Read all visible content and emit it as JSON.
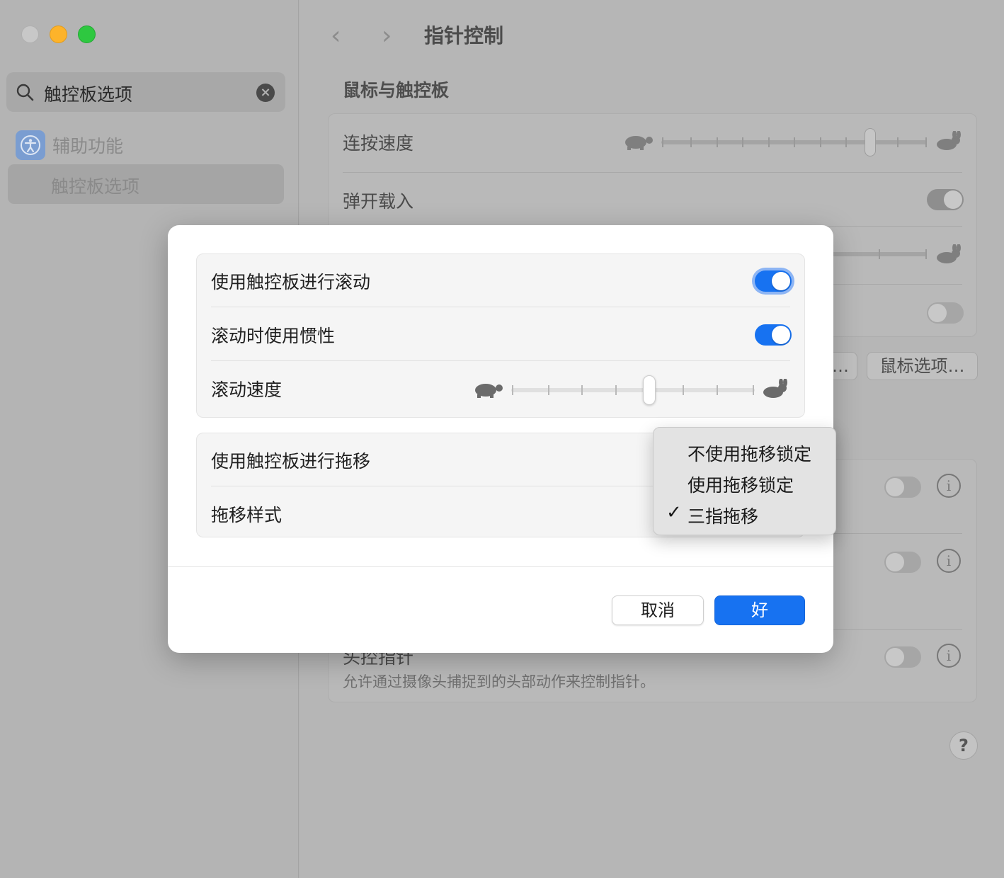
{
  "window": {
    "sidebar": {
      "search_value": "触控板选项",
      "group_label": "辅助功能",
      "selected_item": "触控板选项"
    },
    "header": {
      "back": "‹",
      "forward": "›",
      "title": "指针控制"
    },
    "mouse_trackpad": {
      "section_title": "鼠标与触控板",
      "double_click_speed_label": "连按速度",
      "spring_loading_label": "弹开载入",
      "mouse_options_button": "鼠标选项…",
      "partial_button": "…"
    },
    "head_pointer": {
      "title": "头控指针",
      "description": "允许通过摄像头捕捉到的头部动作来控制指针。"
    },
    "help_label": "?"
  },
  "dialog": {
    "scrolling": {
      "use_trackpad_scroll_label": "使用触控板进行滚动",
      "use_trackpad_scroll_on": true,
      "inertia_label": "滚动时使用惯性",
      "inertia_on": true,
      "scroll_speed_label": "滚动速度"
    },
    "dragging": {
      "use_trackpad_drag_label": "使用触控板进行拖移",
      "drag_style_label": "拖移样式"
    },
    "drag_style_menu": {
      "options": [
        "不使用拖移锁定",
        "使用拖移锁定",
        "三指拖移"
      ],
      "selected": "三指拖移",
      "checkmark": "✓"
    },
    "cancel_label": "取消",
    "ok_label": "好"
  },
  "colors": {
    "accent": "#1772f1",
    "dim_background": "#b3b3b3"
  }
}
